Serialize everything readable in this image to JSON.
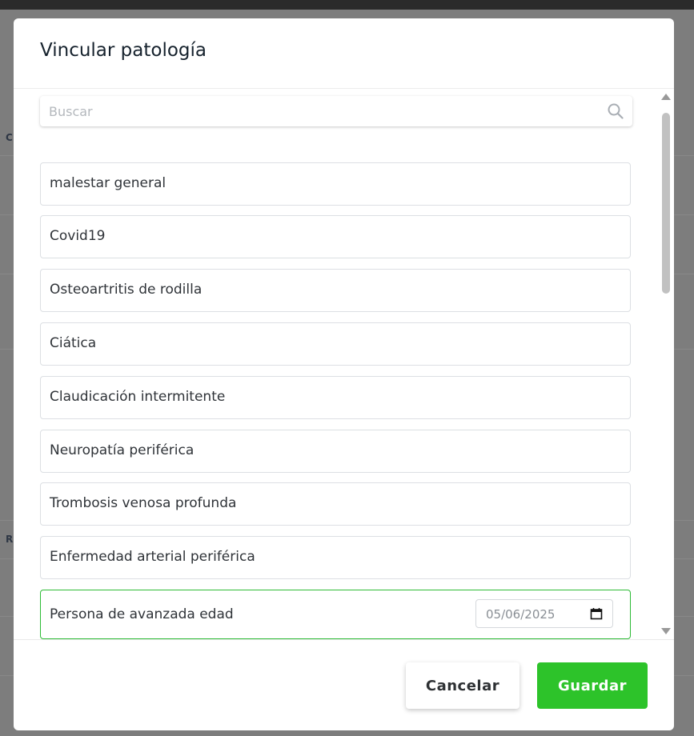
{
  "background": {
    "partial_labels": [
      "CI",
      "R"
    ]
  },
  "modal": {
    "title": "Vincular patología"
  },
  "search": {
    "placeholder": "Buscar",
    "value": ""
  },
  "pathologies": [
    {
      "label": "malestar general",
      "selected": false
    },
    {
      "label": "Covid19",
      "selected": false
    },
    {
      "label": "Osteoartritis de rodilla",
      "selected": false
    },
    {
      "label": "Ciática",
      "selected": false
    },
    {
      "label": "Claudicación intermitente",
      "selected": false
    },
    {
      "label": "Neuropatía periférica",
      "selected": false
    },
    {
      "label": "Trombosis venosa profunda",
      "selected": false
    },
    {
      "label": "Enfermedad arterial periférica",
      "selected": false
    },
    {
      "label": "Persona de avanzada edad",
      "selected": true,
      "date": "05/06/2025"
    }
  ],
  "buttons": {
    "cancel": "Cancelar",
    "save": "Guardar"
  },
  "colors": {
    "accent_green": "#2dc32a",
    "selected_border": "#2dbb35",
    "overlay": "#7f7f7f"
  },
  "icons": {
    "search": "search-icon",
    "calendar": "calendar-icon",
    "scroll_up": "chevron-up-icon",
    "scroll_down": "chevron-down-icon"
  }
}
